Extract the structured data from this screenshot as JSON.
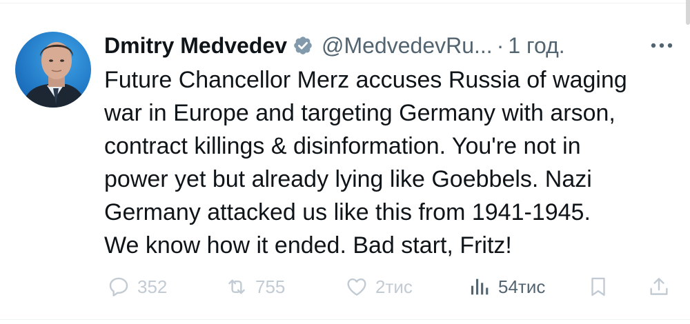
{
  "tweet": {
    "author": {
      "display_name": "Dmitry Medvedev",
      "handle": "@MedvedevRu...",
      "verified": true,
      "avatar": "author-portrait"
    },
    "separator": "·",
    "timestamp": "1 год.",
    "text": "Future Chancellor Merz accuses Russia of waging\nwar in Europe and targeting Germany with arson,\ncontract killings & disinformation. You're not in\npower yet but already lying like Goebbels. Nazi\nGermany attacked us like this from 1941-1945.\nWe know how it ended. Bad start, Fritz!",
    "stats": {
      "replies": "352",
      "retweets": "755",
      "likes": "2тис",
      "views": "54тис"
    }
  },
  "icons": {
    "more": "more-dots-icon",
    "reply": "reply-bubble-icon",
    "retweet": "retweet-icon",
    "like": "heart-icon",
    "views": "views-bar-chart-icon",
    "bookmark": "bookmark-icon",
    "share": "share-icon",
    "verified": "verified-badge-icon"
  },
  "colors": {
    "text_primary": "#0f1419",
    "text_secondary": "#536471",
    "faded_action": "#c2cbd3",
    "verified_badge": "#829aab"
  }
}
